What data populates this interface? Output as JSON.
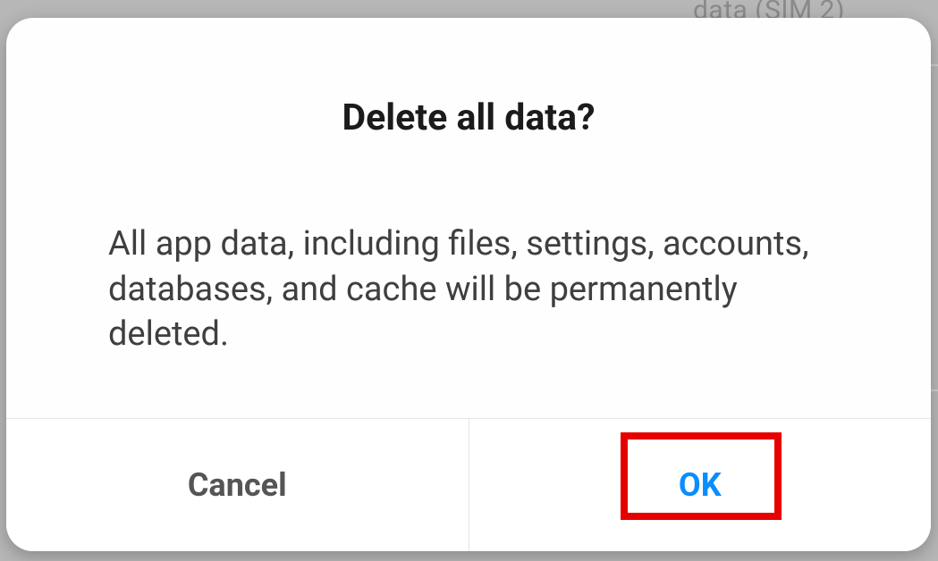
{
  "background": {
    "partial_text": "data (SIM 2)"
  },
  "dialog": {
    "title": "Delete all data?",
    "message": "All app data, including files, settings, accounts, databases, and cache will be permanently deleted.",
    "actions": {
      "cancel": "Cancel",
      "ok": "OK"
    }
  }
}
